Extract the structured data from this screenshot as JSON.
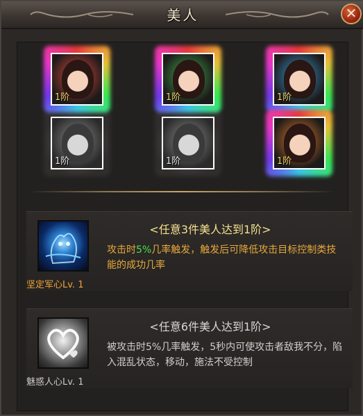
{
  "window": {
    "title": "美人",
    "close_label": "✕"
  },
  "beauties": [
    {
      "level": "1阶",
      "color": "#e0483c",
      "active": true
    },
    {
      "level": "1阶",
      "color": "#3fae4a",
      "active": true
    },
    {
      "level": "1阶",
      "color": "#3a9ad8",
      "active": true
    },
    {
      "level": "1阶",
      "color": "#9a9a9a",
      "active": false
    },
    {
      "level": "1阶",
      "color": "#a0a0a0",
      "active": false
    },
    {
      "level": "1阶",
      "color": "#e07a2a",
      "active": true
    }
  ],
  "skills": [
    {
      "name": "坚定军心Lv. 1",
      "title": "<任意3件美人达到1阶>",
      "desc_prefix": "攻击时",
      "desc_highlight": "5%",
      "desc_suffix": "几率触发，触发后可降低攻击目标控制类技能的成功几率",
      "active": true
    },
    {
      "name": "魅惑人心Lv. 1",
      "title": "<任意6件美人达到1阶>",
      "desc": "被攻击时5%几率触发，5秒内可使攻击者敌我不分，陷入混乱状态，移动，施法不受控制",
      "active": false
    }
  ]
}
